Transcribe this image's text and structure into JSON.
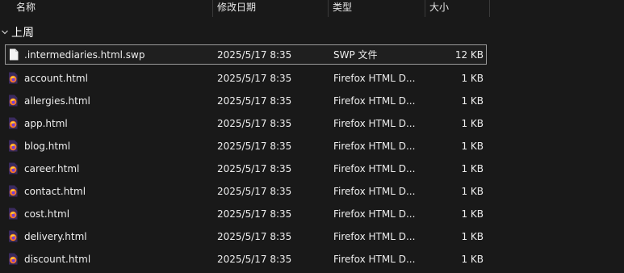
{
  "columns": {
    "name": "名称",
    "date": "修改日期",
    "type": "类型",
    "size": "大小"
  },
  "group": {
    "label": "上周"
  },
  "files": [
    {
      "name": ".intermediaries.html.swp",
      "date": "2025/5/17 8:35",
      "type": "SWP 文件",
      "size": "12 KB",
      "icon": "generic-file-icon",
      "selected": true
    },
    {
      "name": "account.html",
      "date": "2025/5/17 8:35",
      "type": "Firefox HTML D...",
      "size": "1 KB",
      "icon": "firefox-html-icon"
    },
    {
      "name": "allergies.html",
      "date": "2025/5/17 8:35",
      "type": "Firefox HTML D...",
      "size": "1 KB",
      "icon": "firefox-html-icon"
    },
    {
      "name": "app.html",
      "date": "2025/5/17 8:35",
      "type": "Firefox HTML D...",
      "size": "1 KB",
      "icon": "firefox-html-icon"
    },
    {
      "name": "blog.html",
      "date": "2025/5/17 8:35",
      "type": "Firefox HTML D...",
      "size": "1 KB",
      "icon": "firefox-html-icon"
    },
    {
      "name": "career.html",
      "date": "2025/5/17 8:35",
      "type": "Firefox HTML D...",
      "size": "1 KB",
      "icon": "firefox-html-icon"
    },
    {
      "name": "contact.html",
      "date": "2025/5/17 8:35",
      "type": "Firefox HTML D...",
      "size": "1 KB",
      "icon": "firefox-html-icon"
    },
    {
      "name": "cost.html",
      "date": "2025/5/17 8:35",
      "type": "Firefox HTML D...",
      "size": "1 KB",
      "icon": "firefox-html-icon"
    },
    {
      "name": "delivery.html",
      "date": "2025/5/17 8:35",
      "type": "Firefox HTML D...",
      "size": "1 KB",
      "icon": "firefox-html-icon"
    },
    {
      "name": "discount.html",
      "date": "2025/5/17 8:35",
      "type": "Firefox HTML D...",
      "size": "1 KB",
      "icon": "firefox-html-icon"
    }
  ],
  "colors": {
    "background": "#191919",
    "selection_border": "#9a9a9a",
    "text": "#ededed"
  }
}
